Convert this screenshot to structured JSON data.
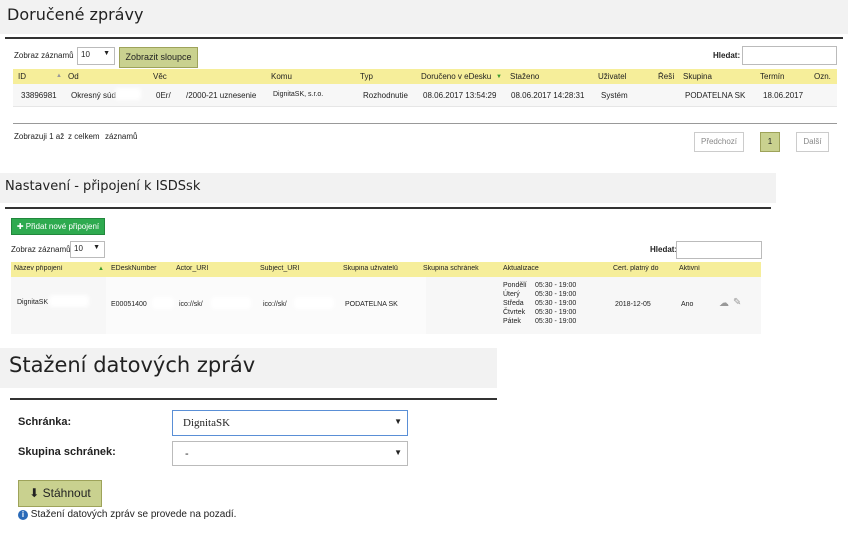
{
  "received": {
    "title": "Doručené zprávy",
    "show_label": "Zobraz záznamů",
    "show_value": "10",
    "columns_button": "Zobrazit sloupce",
    "search_label": "Hledat:",
    "columns": [
      "ID",
      "Od",
      "Věc",
      "Komu",
      "Typ",
      "Doručeno v eDesku",
      "Staženo",
      "Uživatel",
      "Řeší",
      "Skupina",
      "Termín",
      "Ozn."
    ],
    "row": {
      "id": "33896981",
      "od": "Okresný súd",
      "vec_a": "0Er/",
      "vec_b": "/2000-21 uznesenie",
      "komu": "DignitaSK, s.r.o.",
      "typ": "Rozhodnutie",
      "doruceno": "08.06.2017 13:54:29",
      "stazeno": "08.06.2017 14:28:31",
      "uzivatel": "Systém",
      "skupina": "PODATELNA SK",
      "termin": "18.06.2017"
    },
    "footer_a": "Zobrazuji 1 až",
    "footer_b": "z celkem",
    "footer_c": "záznamů",
    "prev": "Předchozí",
    "page": "1",
    "next": "Další"
  },
  "isds": {
    "title": "Nastavení - připojení k ISDSsk",
    "add_button": "Přidat nové připojení",
    "show_label": "Zobraz záznamů",
    "show_value": "10",
    "search_label": "Hledat:",
    "columns": [
      "Název připojení",
      "EDeskNumber",
      "Actor_URI",
      "Subject_URI",
      "Skupina uživatelů",
      "Skupina schránek",
      "Aktualizace",
      "Cert. platný do",
      "Aktivní"
    ],
    "row": {
      "name": "DignitaSK",
      "edesk": "E00051400",
      "actor": "ico://sk/",
      "subject": "ico://sk/",
      "group": "PODATELNA SK",
      "schedule": [
        {
          "day": "Pondělí",
          "time": "05:30 - 19:00"
        },
        {
          "day": "Úterý",
          "time": "05:30 - 19:00"
        },
        {
          "day": "Středa",
          "time": "05:30 - 19:00"
        },
        {
          "day": "Čtvrtek",
          "time": "05:30 - 19:00"
        },
        {
          "day": "Pátek",
          "time": "05:30 - 19:00"
        }
      ],
      "cert": "2018-12-05",
      "active": "Ano"
    }
  },
  "download": {
    "title": "Stažení datových zpráv",
    "box_label": "Schránka:",
    "box_value": "DignitaSK",
    "group_label": "Skupina schránek:",
    "group_value": "-",
    "button": "Stáhnout",
    "info": "Stažení datových zpráv se provede na pozadí."
  },
  "colors": {
    "header_yellow": "#f6ee9a",
    "olive_button": "#c9d18f",
    "green_button": "#2eaa4f",
    "info_blue": "#2a6ab8"
  }
}
